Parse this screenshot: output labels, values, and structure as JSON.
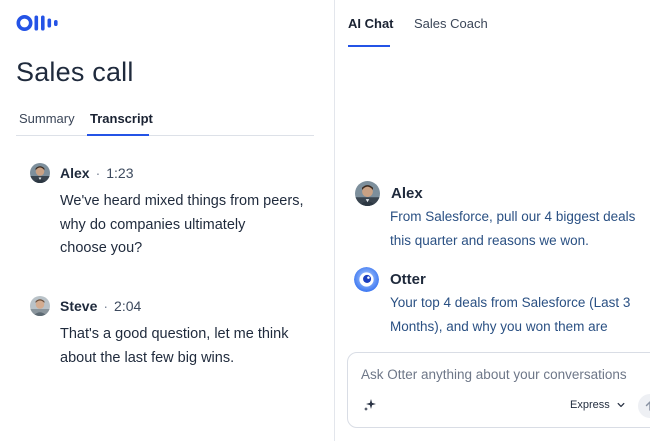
{
  "app": {
    "logo_icon": "otter-logo-icon",
    "brand_color": "#2453e6"
  },
  "left": {
    "title": "Sales call",
    "tabs": [
      {
        "label": "Summary",
        "active": false
      },
      {
        "label": "Transcript",
        "active": true
      }
    ],
    "messages": [
      {
        "speaker": "Alex",
        "separator": "·",
        "time": "1:23",
        "lines": [
          "We've heard mixed things from peers,",
          "why do companies ultimately",
          "choose you?"
        ]
      },
      {
        "speaker": "Steve",
        "separator": "·",
        "time": "2:04",
        "lines": [
          "That's a good question, let me think",
          "about the last few big wins."
        ]
      }
    ]
  },
  "right": {
    "tabs": [
      {
        "label": "AI Chat",
        "active": true
      },
      {
        "label": "Sales Coach",
        "active": false
      }
    ],
    "chat": [
      {
        "name": "Alex",
        "avatar_icon": "user-avatar",
        "lines": [
          "From Salesforce, pull our 4 biggest deals",
          "this quarter and reasons we won."
        ]
      },
      {
        "name": "Otter",
        "avatar_icon": "otter-avatar-icon",
        "lines": [
          "Your top 4 deals from Salesforce (Last 3",
          "Months), and why you won them are"
        ]
      }
    ],
    "composer": {
      "placeholder": "Ask Otter anything about your conversations",
      "mode": "Express",
      "sparkle_icon": "sparkle-icon",
      "chevron_icon": "chevron-down-icon",
      "send_icon": "send-icon"
    }
  }
}
